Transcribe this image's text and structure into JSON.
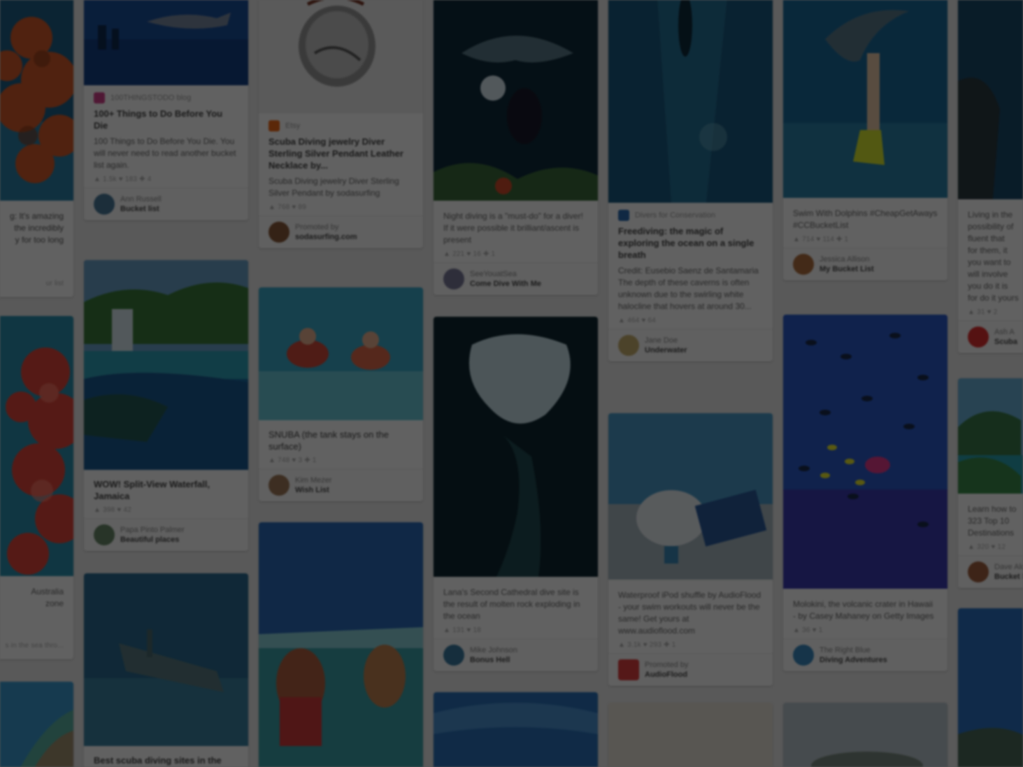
{
  "columns": [
    [
      {
        "img": "reef-orange",
        "h": 287,
        "title": "",
        "desc": "g: It's amazing\nthe incredibly\ny for too long",
        "stats": "",
        "pinner": "",
        "board": "",
        "footer_line": "ur list"
      },
      {
        "img": "soft-coral",
        "h": 372
      },
      {
        "img": "",
        "h": 0,
        "title": "",
        "desc": "Australia\nzone",
        "stats": "",
        "pinner": "",
        "board": "",
        "footer_line": "s in the sea thro..."
      },
      {
        "img": "island-aerial",
        "h": 130
      }
    ],
    [
      {
        "img": "shark-divers",
        "h": 122,
        "source": "100THINGSTODO blog",
        "title": "100+ Things to Do Before You Die",
        "desc": "100 Things to Do Before You Die. You will never need to read another bucket list again.",
        "stats": "▲ 1.5k   ♥ 183   ✚ 4",
        "pinner": "Ann Russell",
        "board": "Bucket list",
        "badge": "#d0418a",
        "avatar": "#4a7a9a"
      },
      {
        "img": "waterfall",
        "h": 300,
        "title": "",
        "desc": "WOW! Split-View Waterfall, Jamaica",
        "stats": "▲ 398   ♥ 42",
        "pinner": "Papa Pinto Palmer",
        "board": "Beautiful places",
        "avatar": "#6a8a6a"
      },
      {
        "img": "shipwreck",
        "h": 245,
        "title": "",
        "desc": "Best scuba diving sites in the",
        "stats": ""
      }
    ],
    [
      {
        "img": "silver-pendant",
        "h": 162,
        "source": "Etsy",
        "title": "Scuba Diving jewelry Diver Sterling Silver Pendant Leather Necklace by...",
        "desc": "Scuba Diving jewelry Diver Sterling Silver Pendant by sodasurfing",
        "stats": "▲ 768   ♥ 89",
        "pinner": "Promoted by",
        "board": "sodasurfing.com",
        "badge": "#f06a1a",
        "avatar": "#8a5a3a"
      },
      {
        "img": "snorkel-pair",
        "h": 190,
        "title": "",
        "desc": "SNUBA (the tank stays on the surface)",
        "stats": "▲ 748   ♥ 3   ✚ 1",
        "pinner": "Kim Mezer",
        "board": "Wish List",
        "avatar": "#a07a5a"
      },
      {
        "img": "split-view",
        "h": 350
      }
    ],
    [
      {
        "img": "manta-night",
        "h": 287,
        "title": "",
        "desc": "Night diving is a \"must-do\" for a diver! If it were possible it brilliant/ascent is present",
        "stats": "▲ 221   ♥ 16   ✚ 1",
        "pinner": "SeeYouatSea",
        "board": "Come Dive With Me",
        "avatar": "#7a7a9a"
      },
      {
        "img": "cavern",
        "h": 372,
        "title": "",
        "desc": "Lana's Second Cathedral dive site is the result of molten rock exploding in the ocean",
        "stats": "▲ 131   ♥ 18",
        "pinner": "Mike Johnson",
        "board": "Bonus Hell",
        "avatar": "#3a7aa0"
      },
      {
        "img": "blue-water",
        "h": 110
      }
    ],
    [
      {
        "img": "freediver-deep",
        "h": 290,
        "source": "Divers for Conservation",
        "title": "Freediving: the magic of exploring the ocean on a single breath",
        "desc": "Credit: Eusebio Saenz de Santamaria The depth of these caverns is often unknown due to the swirling white halocline that hovers at around 30...",
        "stats": "▲ 464   ♥ 64",
        "pinner": "Jane Doe",
        "board": "Underwater",
        "badge": "#2a6ab0",
        "avatar": "#c8b070"
      },
      {
        "img": "ipod-waterproof",
        "h": 238,
        "title": "",
        "desc": "Waterproof iPod shuffle by AudioFlood - your swim workouts will never be the same! Get yours at www.audioflood.com",
        "stats": "▲ 3.1k   ♥ 293   ✚ 1",
        "pinner": "Promoted by",
        "board": "AudioFlood",
        "avatar": "#e04040"
      },
      {
        "img": "sand",
        "h": 95
      }
    ],
    [
      {
        "img": "whale-shark",
        "h": 283,
        "title": "",
        "desc": "Swim With Dolphins #CheapGetAways #CCBucketList",
        "stats": "▲ 714   ♥ 114   ✚ 1",
        "pinner": "Jessica Allison",
        "board": "My Bucket List",
        "avatar": "#b07040"
      },
      {
        "img": "fish-school",
        "h": 392,
        "title": "",
        "desc": "Molokini, the volcanic crater in Hawaii - by Casey Mahaney on Getty Images",
        "stats": "▲ 36   ♥ 1",
        "pinner": "The Right Blue",
        "board": "Diving Adventures",
        "avatar": "#3a8ac0"
      },
      {
        "img": "island-hazy",
        "h": 95
      }
    ],
    [
      {
        "img": "diver-dark",
        "h": 285,
        "title": "",
        "desc": "Living in the\npossibility of\nfluent that\nfor them, it\nyou want to\nwill involve\nyou do it is\nfor do it yours",
        "stats": "▲ 31   ♥ 2",
        "pinner": "Ash A",
        "board": "Scuba",
        "avatar": "#e03030"
      },
      {
        "img": "tropic-island",
        "h": 165,
        "title": "",
        "desc": "Learn how to\n323 Top 10\nDestinations",
        "stats": "▲ 320   ♥ 12",
        "pinner": "Dave Alq",
        "board": "Bucket list",
        "avatar": "#a06040"
      },
      {
        "img": "coast-blue",
        "h": 230
      }
    ]
  ],
  "overlay_color": "#000000"
}
